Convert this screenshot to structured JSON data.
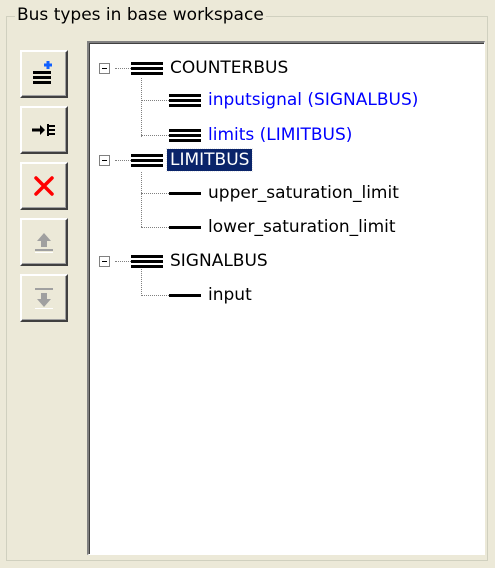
{
  "group": {
    "title": "Bus types in base workspace"
  },
  "toolbar": {
    "buttons": [
      {
        "name": "add-bus-button",
        "icon": "add-bus-icon",
        "enabled": true
      },
      {
        "name": "insert-element-button",
        "icon": "insert-element-icon",
        "enabled": true
      },
      {
        "name": "delete-button",
        "icon": "delete-icon",
        "enabled": true
      },
      {
        "name": "move-up-button",
        "icon": "move-up-icon",
        "enabled": false
      },
      {
        "name": "move-down-button",
        "icon": "move-down-icon",
        "enabled": false
      }
    ]
  },
  "tree": {
    "nodes": [
      {
        "label": "COUNTERBUS",
        "type": "bus",
        "expanded": true,
        "children": [
          {
            "label": "inputsignal  (SIGNALBUS)",
            "type": "bus-element",
            "color": "#0000ff"
          },
          {
            "label": "limits  (LIMITBUS)",
            "type": "bus-element",
            "color": "#0000ff"
          }
        ]
      },
      {
        "label": "LIMITBUS",
        "type": "bus",
        "expanded": true,
        "selected": true,
        "children": [
          {
            "label": "upper_saturation_limit",
            "type": "signal"
          },
          {
            "label": "lower_saturation_limit",
            "type": "signal"
          }
        ]
      },
      {
        "label": "SIGNALBUS",
        "type": "bus",
        "expanded": true,
        "children": [
          {
            "label": "input",
            "type": "signal"
          }
        ]
      }
    ]
  },
  "colors": {
    "selection": "#0a246a",
    "link": "#0000ff",
    "background": "#ece9d8"
  }
}
